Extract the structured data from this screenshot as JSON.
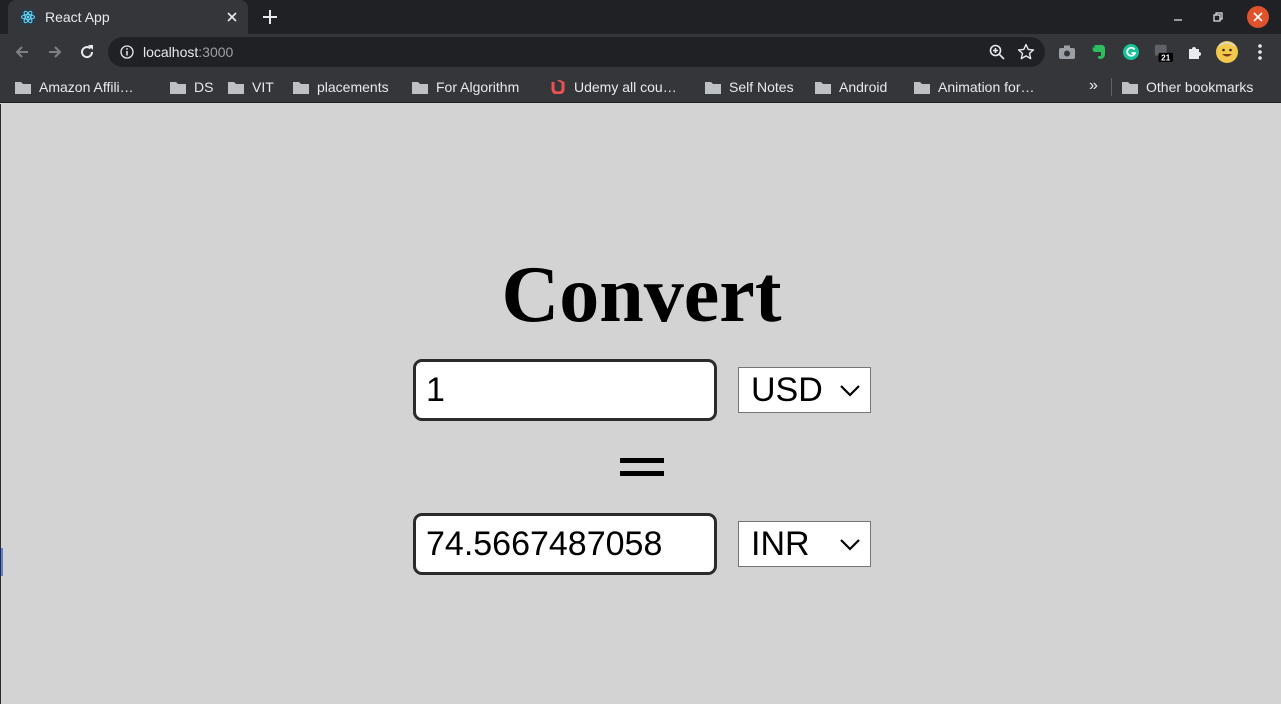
{
  "browser": {
    "tab": {
      "title": "React App",
      "favicon": "react-logo-icon"
    },
    "address": {
      "host": "localhost",
      "port": ":3000"
    },
    "extensions": [
      {
        "name": "camera-icon"
      },
      {
        "name": "evernote-icon"
      },
      {
        "name": "grammarly-icon"
      },
      {
        "name": "counter-extension-icon",
        "badge": "21"
      },
      {
        "name": "puzzle-icon"
      },
      {
        "name": "profile-avatar"
      },
      {
        "name": "menu-dots-icon"
      }
    ],
    "bookmarks": [
      {
        "label": "Amazon Affili…",
        "icon": "folder-icon"
      },
      {
        "label": "DS",
        "icon": "folder-icon"
      },
      {
        "label": "VIT",
        "icon": "folder-icon"
      },
      {
        "label": "placements",
        "icon": "folder-icon"
      },
      {
        "label": "For Algorithm",
        "icon": "folder-icon"
      },
      {
        "label": "Udemy all cou…",
        "icon": "udemy-icon"
      },
      {
        "label": "Self Notes",
        "icon": "folder-icon"
      },
      {
        "label": "Android",
        "icon": "folder-icon"
      },
      {
        "label": "Animation for…",
        "icon": "folder-icon"
      }
    ],
    "more_bookmarks": "»",
    "other_bookmarks": "Other bookmarks"
  },
  "app": {
    "title": "Convert",
    "from": {
      "amount": "1",
      "currency": "USD"
    },
    "equals": "=",
    "to": {
      "amount": "74.5667487058",
      "currency": "INR"
    }
  },
  "colors": {
    "page_background": "#d3d3d3",
    "chrome_dark": "#202124",
    "chrome_toolbar": "#35363a",
    "close_button": "#e0522c"
  }
}
